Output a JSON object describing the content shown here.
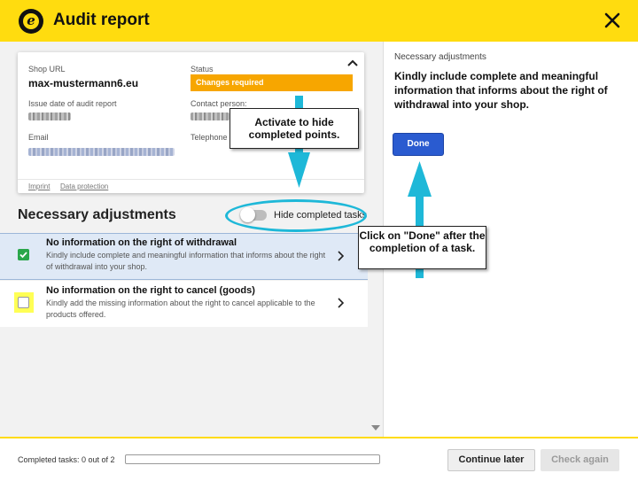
{
  "header": {
    "title": "Audit report",
    "logo_letter": "e",
    "accent_color": "#ffdc0f"
  },
  "card": {
    "shop_url_label": "Shop URL",
    "shop_url_value": "max-mustermann6.eu",
    "status_label": "Status",
    "status_value": "Changes required",
    "issue_date_label": "Issue date of audit report",
    "contact_label": "Contact person:",
    "email_label": "Email",
    "telephone_label": "Telephone",
    "links": [
      "Imprint",
      "Data protection"
    ]
  },
  "section": {
    "title": "Necessary adjustments",
    "toggle_label": "Hide completed tasks"
  },
  "tasks": [
    {
      "title": "No information on the right of withdrawal",
      "description": "Kindly include complete and meaningful information that informs about the right of withdrawal into your shop.",
      "done": true
    },
    {
      "title": "No information on the right to cancel (goods)",
      "description": "Kindly add the missing information about the right to cancel applicable to the products offered.",
      "done": false
    }
  ],
  "detail": {
    "heading": "Necessary adjustments",
    "text": "Kindly include complete and meaningful information that informs about the right of withdrawal into your shop.",
    "done_label": "Done"
  },
  "footer": {
    "completed_label": "Completed tasks: 0 out of 2",
    "completed_fraction": 0,
    "continue_label": "Continue later",
    "check_label": "Check again"
  },
  "callouts": {
    "toggle_hint": "Activate to hide completed points.",
    "done_hint": "Click on \"Done\" after the completion of a task."
  },
  "colors": {
    "callout_cyan": "#1eb8d8",
    "status_orange": "#f7a600",
    "done_blue": "#2a5bd0",
    "check_green": "#2aa64a"
  }
}
